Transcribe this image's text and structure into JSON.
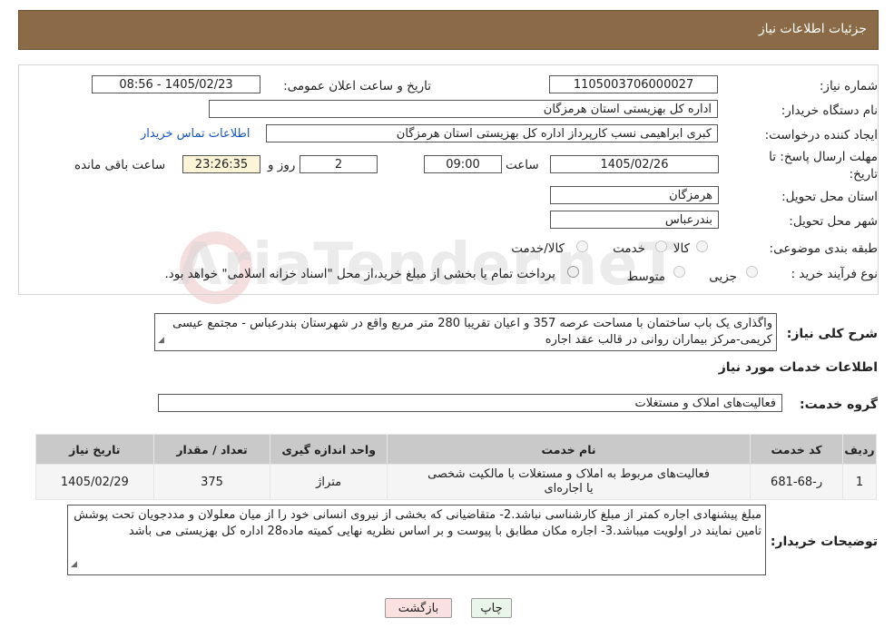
{
  "header": {
    "title": "جزئیات اطلاعات نیاز"
  },
  "fields": {
    "need_number_label": "شماره نیاز:",
    "need_number": "1105003706000027",
    "announce_label": "تاریخ و ساعت اعلان عمومی:",
    "announce_value": "1405/02/23 - 08:56",
    "buyer_org_label": "نام دستگاه خریدار:",
    "buyer_org": "اداره کل بهزیستی استان هرمزگان",
    "creator_label": "ایجاد کننده درخواست:",
    "creator": "کبری  ابراهیمی نسب کارپرداز اداره کل بهزیستی استان هرمزگان",
    "contact_link": "اطلاعات تماس خریدار",
    "deadline_label_1": "مهلت ارسال پاسخ: تا",
    "deadline_label_2": "تاریخ:",
    "deadline_date": "1405/02/26",
    "time_label": "ساعت",
    "deadline_time": "09:00",
    "days_value": "2",
    "days_label": "روز و",
    "remaining_time": "23:26:35",
    "remaining_label": "ساعت باقی مانده",
    "province_label": "استان محل تحویل:",
    "province": "هرمزگان",
    "city_label": "شهر محل تحویل:",
    "city": "بندرعباس",
    "category_label": "طبقه بندی موضوعی:",
    "category_options": [
      "کالا",
      "خدمت",
      "کالا/خدمت"
    ],
    "purchase_type_label": "نوع فرآیند خرید :",
    "purchase_options": [
      "جزیی",
      "متوسط"
    ],
    "purchase_note": "پرداخت تمام یا بخشی از مبلغ خرید،از محل \"اسناد خزانه اسلامی\" خواهد بود."
  },
  "summary": {
    "label": "شرح کلی نیاز:",
    "text": "واگذاری یک باب ساختمان با مساحت عرصه 357 و اعیان تقریبا 280 متر مربع واقع در شهرستان بندرعباس - مجتمع عیسی کریمی-مرکز بیماران روانی در قالب عقد اجاره"
  },
  "services_section": {
    "title": "اطلاعات خدمات مورد نیاز",
    "group_label": "گروه خدمت:",
    "group_value": "فعالیت‌های  املاک و مستغلات"
  },
  "table": {
    "headers": [
      "ردیف",
      "کد خدمت",
      "نام خدمت",
      "واحد اندازه گیری",
      "تعداد / مقدار",
      "تاریخ نیاز"
    ],
    "rows": [
      [
        "1",
        "ر-68-681",
        "فعالیت‌های مربوط به املاک و مستغلات با مالکیت شخصی یا اجاره‌ای",
        "متراژ",
        "375",
        "1405/02/29"
      ]
    ]
  },
  "buyer_notes": {
    "label": "توضیحات خریدار:",
    "text": "مبلغ پیشنهادی  اجاره کمتر از مبلغ کارشناسی نباشد.2- متقاضیانی که بخشی از نیروی انسانی خود را از میان معلولان و مددجویان تحت پوشش تامین نمایند در اولویت میباشد.3-  اجاره مکان  مطابق با پیوست و بر اساس نظریه نهایی کمیته ماده28 اداره کل بهزیستی می باشد"
  },
  "buttons": {
    "print": "چاپ",
    "back": "بازگشت"
  },
  "colors": {
    "header_bg": "#8b6b47",
    "back_button_bg": "#fbe0e0",
    "print_button_bg": "#eaf5ea",
    "link": "#1a55c0"
  }
}
